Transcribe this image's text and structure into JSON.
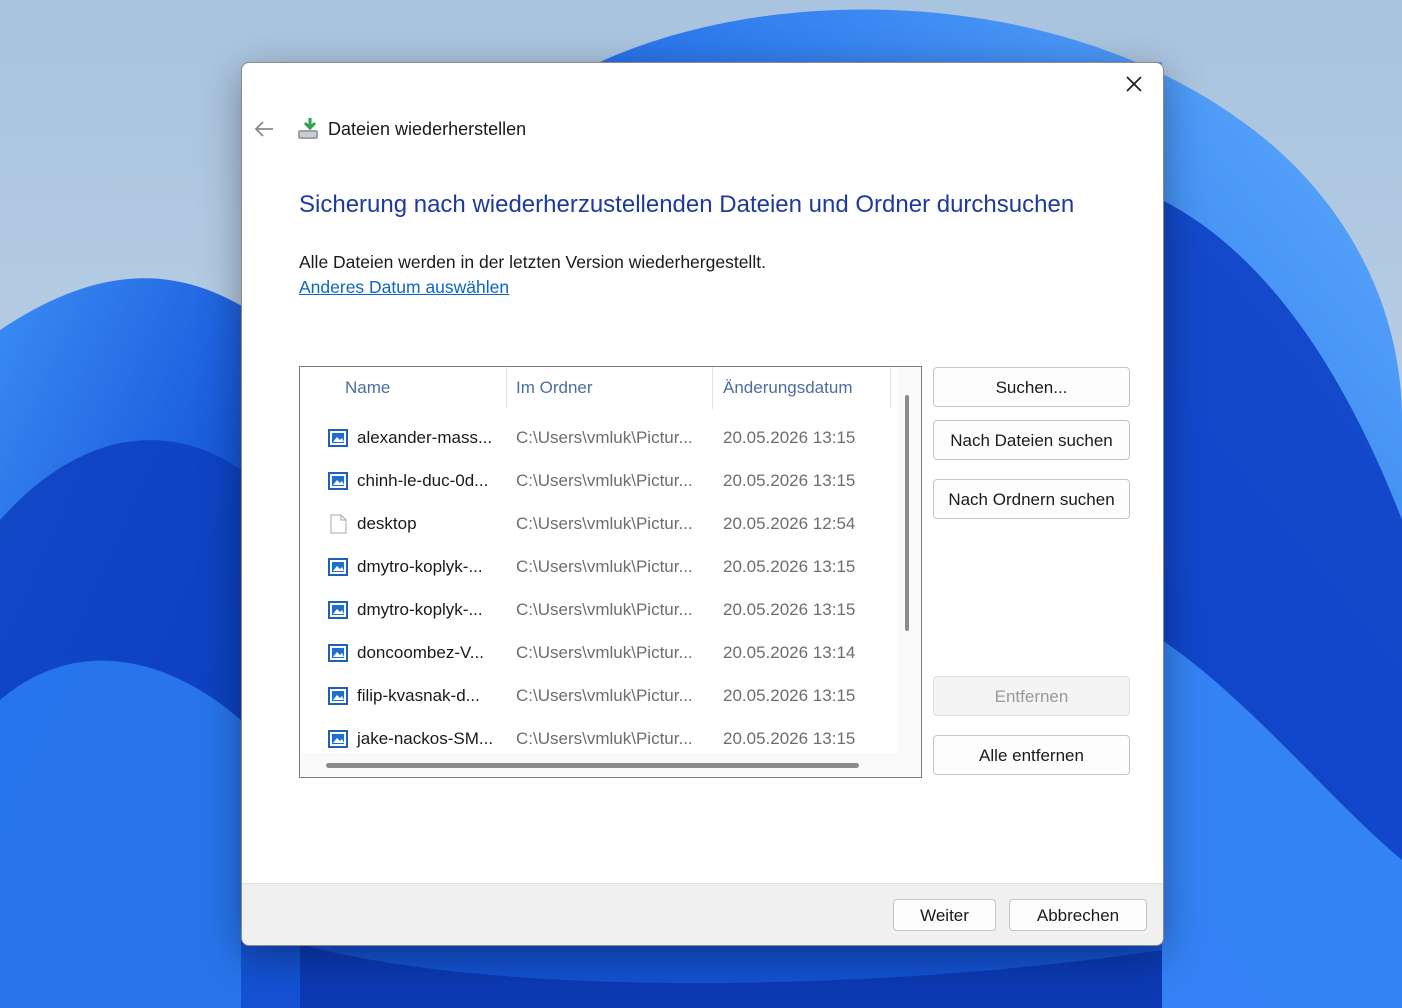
{
  "window": {
    "title": "Dateien wiederherstellen",
    "close_icon": "close-icon",
    "back_icon": "arrow-left-icon"
  },
  "main": {
    "heading": "Sicherung nach wiederherzustellenden Dateien und Ordner durchsuchen",
    "info_text": "Alle Dateien werden in der letzten Version wiederhergestellt.",
    "date_link": "Anderes Datum auswählen"
  },
  "file_list": {
    "columns": [
      "Name",
      "Im Ordner",
      "Änderungsdatum"
    ],
    "rows": [
      {
        "icon": "image-file-icon",
        "name": "alexander-mass...",
        "folder": "C:\\Users\\vmluk\\Pictur...",
        "date": "20.05.2026 13:15"
      },
      {
        "icon": "image-file-icon",
        "name": "chinh-le-duc-0d...",
        "folder": "C:\\Users\\vmluk\\Pictur...",
        "date": "20.05.2026 13:15"
      },
      {
        "icon": "blank-file-icon",
        "name": "desktop",
        "folder": "C:\\Users\\vmluk\\Pictur...",
        "date": "20.05.2026 12:54"
      },
      {
        "icon": "image-file-icon",
        "name": "dmytro-koplyk-...",
        "folder": "C:\\Users\\vmluk\\Pictur...",
        "date": "20.05.2026 13:15"
      },
      {
        "icon": "image-file-icon",
        "name": "dmytro-koplyk-...",
        "folder": "C:\\Users\\vmluk\\Pictur...",
        "date": "20.05.2026 13:15"
      },
      {
        "icon": "image-file-icon",
        "name": "doncoombez-V...",
        "folder": "C:\\Users\\vmluk\\Pictur...",
        "date": "20.05.2026 13:14"
      },
      {
        "icon": "image-file-icon",
        "name": "filip-kvasnak-d...",
        "folder": "C:\\Users\\vmluk\\Pictur...",
        "date": "20.05.2026 13:15"
      },
      {
        "icon": "image-file-icon",
        "name": "jake-nackos-SM...",
        "folder": "C:\\Users\\vmluk\\Pictur...",
        "date": "20.05.2026 13:15"
      }
    ]
  },
  "side_buttons": {
    "search": "Suchen...",
    "search_files": "Nach Dateien suchen",
    "search_folders": "Nach Ordnern suchen",
    "remove": "Entfernen",
    "remove_all": "Alle entfernen"
  },
  "footer": {
    "next": "Weiter",
    "cancel": "Abbrechen"
  },
  "colors": {
    "heading": "#1e3a9c",
    "link": "#0a66c8",
    "wallpaper_blue": "#1b5fd6"
  }
}
